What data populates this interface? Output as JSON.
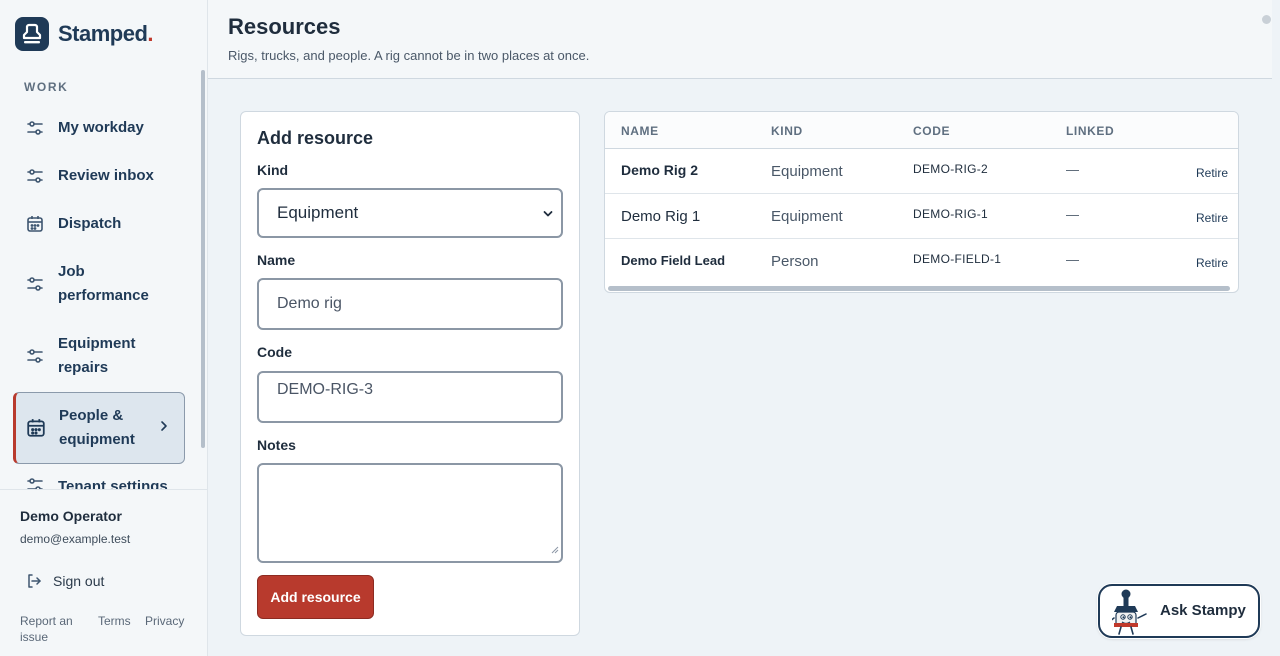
{
  "brand": {
    "name": "Stamped",
    "dot": "."
  },
  "sidebar": {
    "section": "WORK",
    "items": [
      {
        "label": "My workday",
        "icon": "sliders-icon"
      },
      {
        "label": "Review inbox",
        "icon": "sliders-icon"
      },
      {
        "label": "Dispatch",
        "icon": "calendar-icon"
      },
      {
        "label": "Job performance",
        "icon": "sliders-icon"
      },
      {
        "label": "Equipment repairs",
        "icon": "sliders-icon"
      },
      {
        "label": "People & equipment",
        "icon": "calendar-icon",
        "active": true
      },
      {
        "label": "Tenant settings",
        "icon": "sliders-icon"
      }
    ],
    "user": {
      "name": "Demo Operator",
      "email": "demo@example.test"
    },
    "sign_out": "Sign out",
    "footer_links": {
      "report": "Report an issue",
      "terms": "Terms",
      "privacy": "Privacy"
    }
  },
  "header": {
    "title": "Resources",
    "subtitle": "Rigs, trucks, and people. A rig cannot be in two places at once."
  },
  "form": {
    "title": "Add resource",
    "kind_label": "Kind",
    "kind_value": "Equipment",
    "name_label": "Name",
    "name_placeholder": "Demo rig",
    "code_label": "Code",
    "code_placeholder": "DEMO-RIG-3",
    "notes_label": "Notes",
    "submit": "Add resource"
  },
  "table": {
    "columns": [
      "NAME",
      "KIND",
      "CODE",
      "LINKED"
    ],
    "rows": [
      {
        "name": "Demo Rig 2",
        "kind": "Equipment",
        "code": "DEMO-RIG-2",
        "linked": "—",
        "action": "Retire"
      },
      {
        "name": "Demo Rig 1",
        "kind": "Equipment",
        "code": "DEMO-RIG-1",
        "linked": "—",
        "action": "Retire"
      },
      {
        "name": "Demo Field Lead",
        "kind": "Person",
        "code": "DEMO-FIELD-1",
        "linked": "—",
        "action": "Retire"
      }
    ]
  },
  "assistant": {
    "label": "Ask Stampy"
  },
  "colors": {
    "brand_navy": "#1f3a57",
    "accent_red": "#b83a2d",
    "background": "#eef3f7"
  }
}
